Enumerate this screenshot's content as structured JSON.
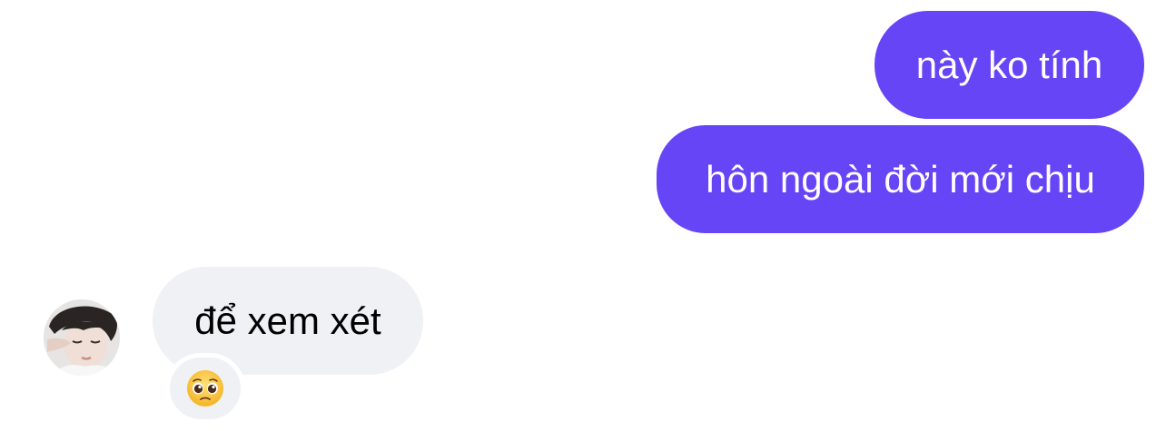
{
  "colors": {
    "sent_bubble": "#6645f6",
    "received_bubble": "#eff1f4",
    "sent_text": "#ffffff",
    "received_text": "#000000"
  },
  "messages": [
    {
      "direction": "sent",
      "text": "này ko tính"
    },
    {
      "direction": "sent",
      "text": "hôn ngoài đời mới chịu"
    },
    {
      "direction": "received",
      "text": "để xem xét",
      "avatar": "sender-avatar-photo",
      "reaction": {
        "icon": "pleading-face-emoji"
      }
    }
  ]
}
